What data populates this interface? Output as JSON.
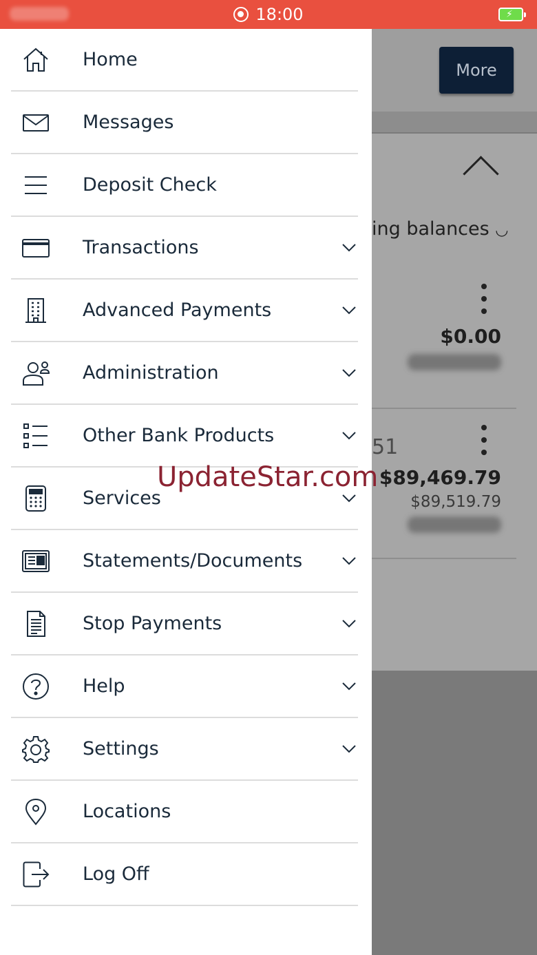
{
  "status_bar": {
    "time": "18:00"
  },
  "background": {
    "more_button": "More",
    "balances_label": "ing balances",
    "account1": {
      "amount": "$0.00"
    },
    "account2": {
      "number_fragment": "51",
      "amount": "$89,469.79",
      "available": "$89,519.79"
    }
  },
  "menu": {
    "items": [
      {
        "label": "Home",
        "icon": "home-icon",
        "expandable": false
      },
      {
        "label": "Messages",
        "icon": "envelope-icon",
        "expandable": false
      },
      {
        "label": "Deposit Check",
        "icon": "menu-lines-icon",
        "expandable": false
      },
      {
        "label": "Transactions",
        "icon": "card-icon",
        "expandable": true
      },
      {
        "label": "Advanced Payments",
        "icon": "building-icon",
        "expandable": true
      },
      {
        "label": "Administration",
        "icon": "users-icon",
        "expandable": true
      },
      {
        "label": "Other Bank Products",
        "icon": "list-icon",
        "expandable": true
      },
      {
        "label": "Services",
        "icon": "calculator-icon",
        "expandable": true
      },
      {
        "label": "Statements/Documents",
        "icon": "newspaper-icon",
        "expandable": true
      },
      {
        "label": "Stop Payments",
        "icon": "document-icon",
        "expandable": true
      },
      {
        "label": "Help",
        "icon": "help-icon",
        "expandable": true
      },
      {
        "label": "Settings",
        "icon": "gear-icon",
        "expandable": true
      },
      {
        "label": "Locations",
        "icon": "location-pin-icon",
        "expandable": false
      },
      {
        "label": "Log Off",
        "icon": "logout-icon",
        "expandable": false
      }
    ]
  },
  "watermark": "UpdateStar.com",
  "colors": {
    "status_bar": "#e9503f",
    "text": "#1a2a3a",
    "more_button": "#0d1f36"
  }
}
